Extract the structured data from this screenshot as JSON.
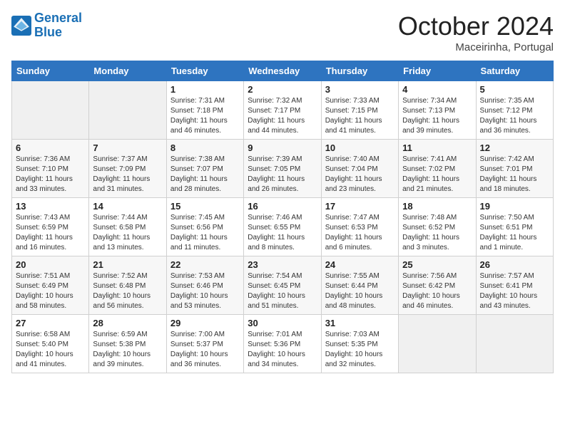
{
  "header": {
    "logo_line1": "General",
    "logo_line2": "Blue",
    "month_title": "October 2024",
    "location": "Maceirinha, Portugal"
  },
  "weekdays": [
    "Sunday",
    "Monday",
    "Tuesday",
    "Wednesday",
    "Thursday",
    "Friday",
    "Saturday"
  ],
  "weeks": [
    [
      {
        "day": "",
        "empty": true
      },
      {
        "day": "",
        "empty": true
      },
      {
        "day": "1",
        "sunrise": "Sunrise: 7:31 AM",
        "sunset": "Sunset: 7:18 PM",
        "daylight": "Daylight: 11 hours and 46 minutes."
      },
      {
        "day": "2",
        "sunrise": "Sunrise: 7:32 AM",
        "sunset": "Sunset: 7:17 PM",
        "daylight": "Daylight: 11 hours and 44 minutes."
      },
      {
        "day": "3",
        "sunrise": "Sunrise: 7:33 AM",
        "sunset": "Sunset: 7:15 PM",
        "daylight": "Daylight: 11 hours and 41 minutes."
      },
      {
        "day": "4",
        "sunrise": "Sunrise: 7:34 AM",
        "sunset": "Sunset: 7:13 PM",
        "daylight": "Daylight: 11 hours and 39 minutes."
      },
      {
        "day": "5",
        "sunrise": "Sunrise: 7:35 AM",
        "sunset": "Sunset: 7:12 PM",
        "daylight": "Daylight: 11 hours and 36 minutes."
      }
    ],
    [
      {
        "day": "6",
        "sunrise": "Sunrise: 7:36 AM",
        "sunset": "Sunset: 7:10 PM",
        "daylight": "Daylight: 11 hours and 33 minutes."
      },
      {
        "day": "7",
        "sunrise": "Sunrise: 7:37 AM",
        "sunset": "Sunset: 7:09 PM",
        "daylight": "Daylight: 11 hours and 31 minutes."
      },
      {
        "day": "8",
        "sunrise": "Sunrise: 7:38 AM",
        "sunset": "Sunset: 7:07 PM",
        "daylight": "Daylight: 11 hours and 28 minutes."
      },
      {
        "day": "9",
        "sunrise": "Sunrise: 7:39 AM",
        "sunset": "Sunset: 7:05 PM",
        "daylight": "Daylight: 11 hours and 26 minutes."
      },
      {
        "day": "10",
        "sunrise": "Sunrise: 7:40 AM",
        "sunset": "Sunset: 7:04 PM",
        "daylight": "Daylight: 11 hours and 23 minutes."
      },
      {
        "day": "11",
        "sunrise": "Sunrise: 7:41 AM",
        "sunset": "Sunset: 7:02 PM",
        "daylight": "Daylight: 11 hours and 21 minutes."
      },
      {
        "day": "12",
        "sunrise": "Sunrise: 7:42 AM",
        "sunset": "Sunset: 7:01 PM",
        "daylight": "Daylight: 11 hours and 18 minutes."
      }
    ],
    [
      {
        "day": "13",
        "sunrise": "Sunrise: 7:43 AM",
        "sunset": "Sunset: 6:59 PM",
        "daylight": "Daylight: 11 hours and 16 minutes."
      },
      {
        "day": "14",
        "sunrise": "Sunrise: 7:44 AM",
        "sunset": "Sunset: 6:58 PM",
        "daylight": "Daylight: 11 hours and 13 minutes."
      },
      {
        "day": "15",
        "sunrise": "Sunrise: 7:45 AM",
        "sunset": "Sunset: 6:56 PM",
        "daylight": "Daylight: 11 hours and 11 minutes."
      },
      {
        "day": "16",
        "sunrise": "Sunrise: 7:46 AM",
        "sunset": "Sunset: 6:55 PM",
        "daylight": "Daylight: 11 hours and 8 minutes."
      },
      {
        "day": "17",
        "sunrise": "Sunrise: 7:47 AM",
        "sunset": "Sunset: 6:53 PM",
        "daylight": "Daylight: 11 hours and 6 minutes."
      },
      {
        "day": "18",
        "sunrise": "Sunrise: 7:48 AM",
        "sunset": "Sunset: 6:52 PM",
        "daylight": "Daylight: 11 hours and 3 minutes."
      },
      {
        "day": "19",
        "sunrise": "Sunrise: 7:50 AM",
        "sunset": "Sunset: 6:51 PM",
        "daylight": "Daylight: 11 hours and 1 minute."
      }
    ],
    [
      {
        "day": "20",
        "sunrise": "Sunrise: 7:51 AM",
        "sunset": "Sunset: 6:49 PM",
        "daylight": "Daylight: 10 hours and 58 minutes."
      },
      {
        "day": "21",
        "sunrise": "Sunrise: 7:52 AM",
        "sunset": "Sunset: 6:48 PM",
        "daylight": "Daylight: 10 hours and 56 minutes."
      },
      {
        "day": "22",
        "sunrise": "Sunrise: 7:53 AM",
        "sunset": "Sunset: 6:46 PM",
        "daylight": "Daylight: 10 hours and 53 minutes."
      },
      {
        "day": "23",
        "sunrise": "Sunrise: 7:54 AM",
        "sunset": "Sunset: 6:45 PM",
        "daylight": "Daylight: 10 hours and 51 minutes."
      },
      {
        "day": "24",
        "sunrise": "Sunrise: 7:55 AM",
        "sunset": "Sunset: 6:44 PM",
        "daylight": "Daylight: 10 hours and 48 minutes."
      },
      {
        "day": "25",
        "sunrise": "Sunrise: 7:56 AM",
        "sunset": "Sunset: 6:42 PM",
        "daylight": "Daylight: 10 hours and 46 minutes."
      },
      {
        "day": "26",
        "sunrise": "Sunrise: 7:57 AM",
        "sunset": "Sunset: 6:41 PM",
        "daylight": "Daylight: 10 hours and 43 minutes."
      }
    ],
    [
      {
        "day": "27",
        "sunrise": "Sunrise: 6:58 AM",
        "sunset": "Sunset: 5:40 PM",
        "daylight": "Daylight: 10 hours and 41 minutes."
      },
      {
        "day": "28",
        "sunrise": "Sunrise: 6:59 AM",
        "sunset": "Sunset: 5:38 PM",
        "daylight": "Daylight: 10 hours and 39 minutes."
      },
      {
        "day": "29",
        "sunrise": "Sunrise: 7:00 AM",
        "sunset": "Sunset: 5:37 PM",
        "daylight": "Daylight: 10 hours and 36 minutes."
      },
      {
        "day": "30",
        "sunrise": "Sunrise: 7:01 AM",
        "sunset": "Sunset: 5:36 PM",
        "daylight": "Daylight: 10 hours and 34 minutes."
      },
      {
        "day": "31",
        "sunrise": "Sunrise: 7:03 AM",
        "sunset": "Sunset: 5:35 PM",
        "daylight": "Daylight: 10 hours and 32 minutes."
      },
      {
        "day": "",
        "empty": true
      },
      {
        "day": "",
        "empty": true
      }
    ]
  ]
}
